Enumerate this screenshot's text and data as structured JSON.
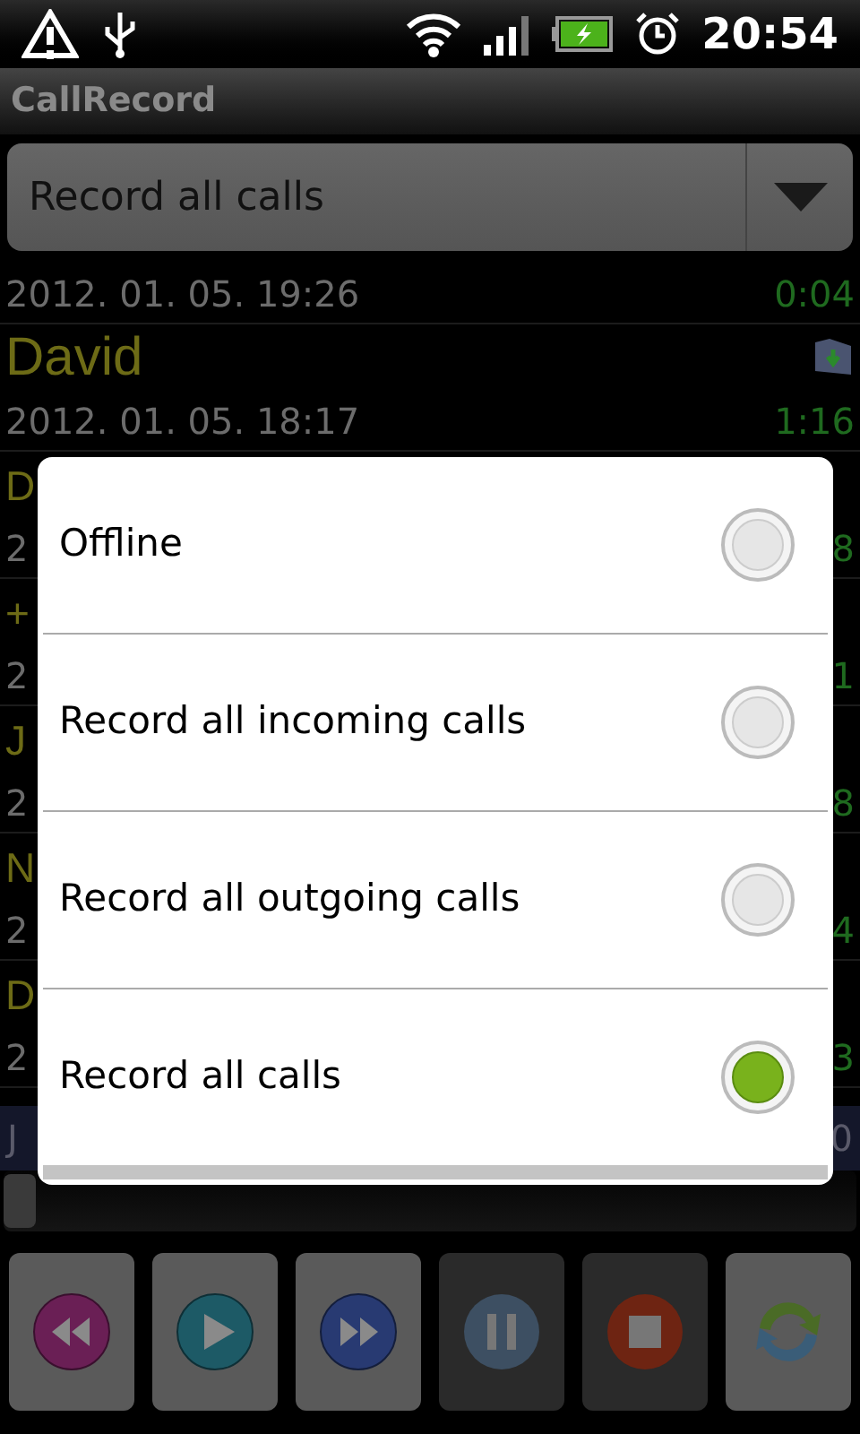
{
  "status_bar": {
    "time": "20:54"
  },
  "window": {
    "title": "CallRecord"
  },
  "mode_spinner": {
    "value": "Record all calls"
  },
  "calls": [
    {
      "date": "2012. 01. 05.  19:26",
      "duration": "0:04",
      "icon": false
    },
    {
      "name": "David",
      "date": "2012. 01. 05.  18:17",
      "duration": "1:16",
      "icon": true
    },
    {
      "name": "D",
      "date": "2",
      "duration": "8",
      "icon": false
    },
    {
      "name": "+",
      "date": "2",
      "duration": "1",
      "icon": false
    },
    {
      "name": "J",
      "date": "2",
      "duration": "8",
      "icon": false
    },
    {
      "name": "N",
      "date": "2",
      "duration": "4",
      "icon": false
    },
    {
      "name": "D",
      "date": "2",
      "duration": "3",
      "icon": false
    }
  ],
  "current": {
    "name": "J",
    "duration": "0",
    "selected": true
  },
  "seek_slider": {
    "level": 0
  },
  "controls": [
    {
      "kind": "rewind",
      "disabled": false
    },
    {
      "kind": "play",
      "disabled": false
    },
    {
      "kind": "forward",
      "disabled": false
    },
    {
      "kind": "pause",
      "disabled": true
    },
    {
      "kind": "stop",
      "disabled": true
    },
    {
      "kind": "refresh",
      "disabled": false
    }
  ],
  "dialog": {
    "options": [
      {
        "label": "Offline",
        "selected": false
      },
      {
        "label": "Record all incoming calls",
        "selected": false
      },
      {
        "label": "Record all outgoing calls",
        "selected": false
      },
      {
        "label": "Record all calls",
        "selected": true
      }
    ]
  }
}
